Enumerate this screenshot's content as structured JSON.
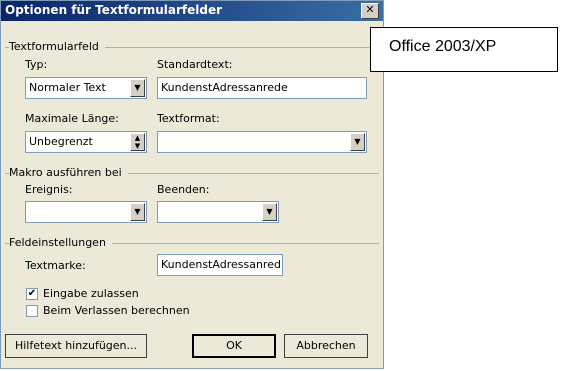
{
  "dialog": {
    "title": "Optionen für Textformularfelder",
    "close_symbol": "✕"
  },
  "textfield_group": {
    "label": "Textformularfeld",
    "type_label": "Typ:",
    "type_value": "Normaler Text",
    "default_text_label": "Standardtext:",
    "default_text_value": "KundenstAdressanrede",
    "max_length_label": "Maximale Länge:",
    "max_length_value": "Unbegrenzt",
    "text_format_label": "Textformat:",
    "text_format_value": ""
  },
  "macro_group": {
    "label": "Makro ausführen bei",
    "event_label": "Ereignis:",
    "event_value": "",
    "exit_label": "Beenden:",
    "exit_value": ""
  },
  "field_settings": {
    "label": "Feldeinstellungen",
    "bookmark_label": "Textmarke:",
    "bookmark_value": "KundenstAdressanred",
    "allow_input_label": "Eingabe zulassen",
    "allow_input_checked": true,
    "calc_on_exit_label": "Beim Verlassen berechnen",
    "calc_on_exit_checked": false
  },
  "buttons": {
    "help_text": "Hilfetext hinzufügen...",
    "ok": "OK",
    "cancel": "Abbrechen"
  },
  "callout": {
    "text": "Office 2003/XP"
  }
}
